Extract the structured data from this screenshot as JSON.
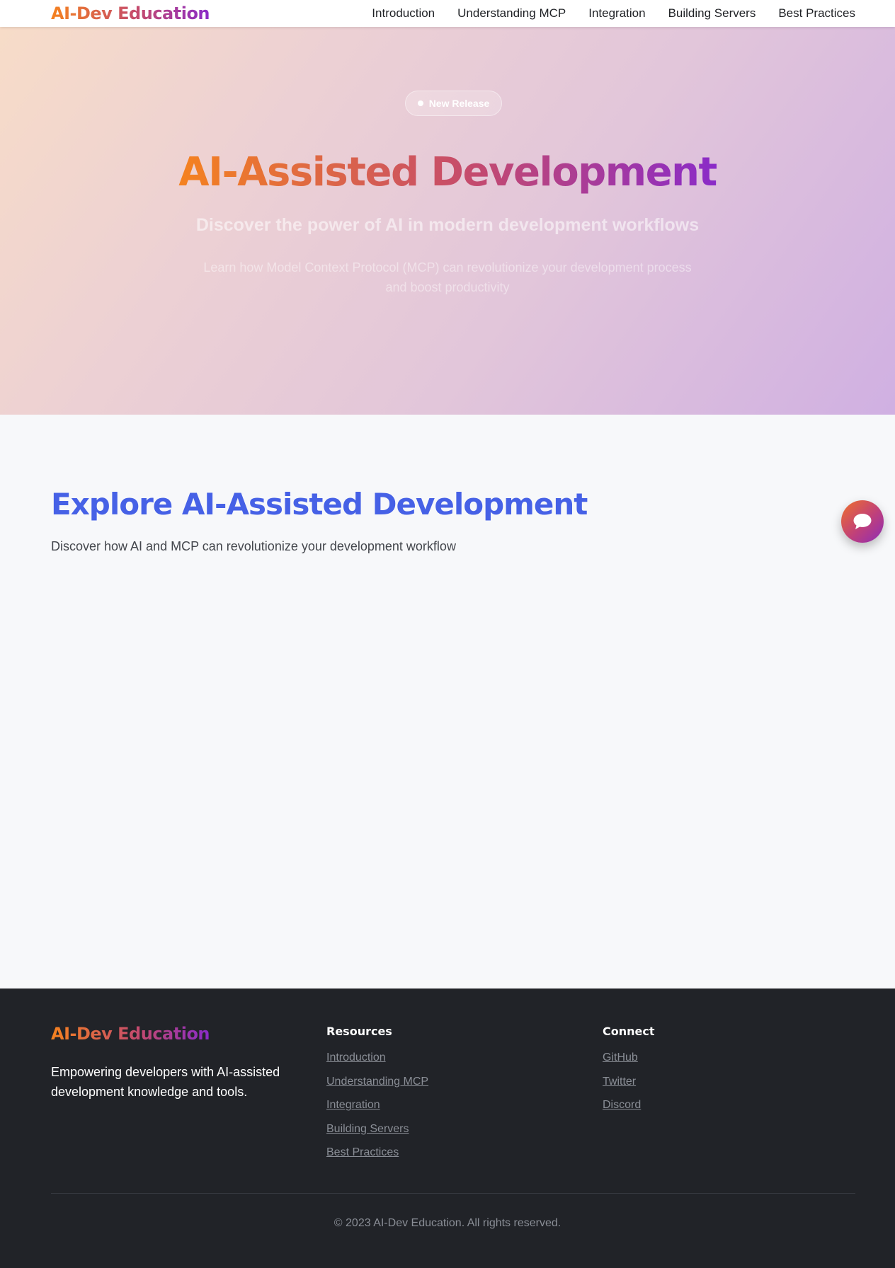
{
  "navbar": {
    "brand": "AI-Dev Education",
    "links": [
      {
        "label": "Introduction"
      },
      {
        "label": "Understanding MCP"
      },
      {
        "label": "Integration"
      },
      {
        "label": "Building Servers"
      },
      {
        "label": "Best Practices"
      }
    ]
  },
  "hero": {
    "badge": "New Release",
    "title": "AI-Assisted Development",
    "subtitle": "Discover the power of AI in modern development workflows",
    "description": "Learn how Model Context Protocol (MCP) can revolutionize your development process and boost productivity"
  },
  "explore": {
    "title": "Explore AI-Assisted Development",
    "subtitle": "Discover how AI and MCP can revolutionize your development workflow"
  },
  "chat_button": {
    "icon": "chat-bubble-icon"
  },
  "footer": {
    "brand": "AI-Dev Education",
    "tagline": "Empowering developers with AI-assisted development knowledge and tools.",
    "resources": {
      "heading": "Resources",
      "links": [
        "Introduction",
        "Understanding MCP",
        "Integration",
        "Building Servers",
        "Best Practices"
      ]
    },
    "connect": {
      "heading": "Connect",
      "links": [
        "GitHub",
        "Twitter",
        "Discord"
      ]
    },
    "copyright": "© 2023 AI-Dev Education. All rights reserved."
  },
  "colors": {
    "brand_gradient_start": "#f5821f",
    "brand_gradient_mid": "#c44a6e",
    "brand_gradient_end": "#8a2bc8",
    "explore_title": "#4661e6",
    "footer_bg": "#212328",
    "footer_link": "#8a8e96"
  }
}
